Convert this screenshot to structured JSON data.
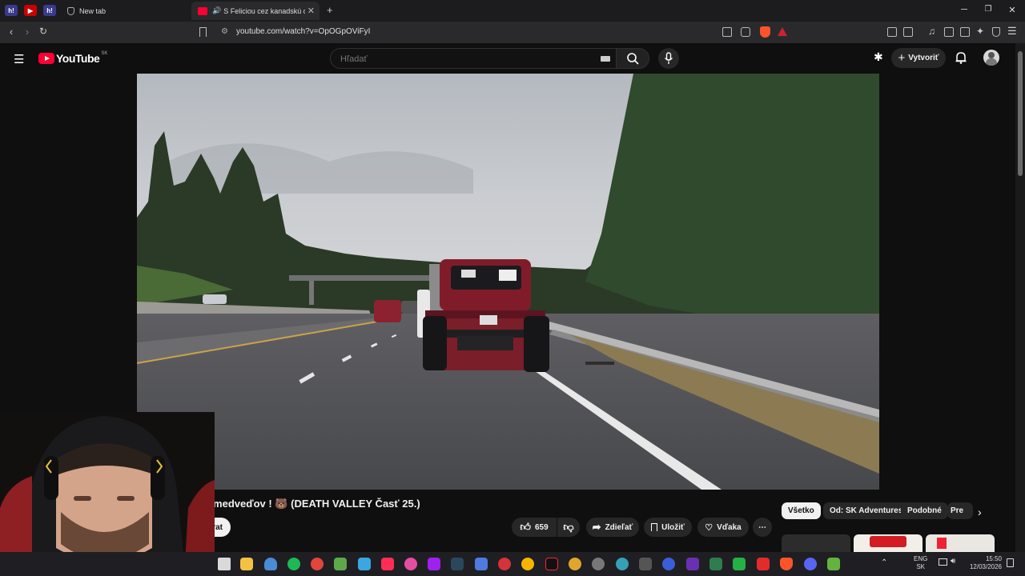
{
  "browser": {
    "tabs": [
      {
        "label": "New tab",
        "active": false
      },
      {
        "label": "S Feliciou cez kanadskú divočinu",
        "active": true
      }
    ],
    "pinned_tabs": [
      "h!",
      "youtube",
      "h!"
    ],
    "new_tab_label": "+",
    "url": "youtube.com/watch?v=OpOGpOViFyI"
  },
  "youtube": {
    "logo_text": "YouTube",
    "region": "SK",
    "search_placeholder": "Hľadať",
    "create_label": "Vytvoriť"
  },
  "video": {
    "title": "...í medveďov ! 🐻 (DEATH VALLEY Časť 25.)",
    "subscribe_partial": "rat",
    "actions": {
      "likes": "659",
      "share": "Zdieľať",
      "save": "Uložiť",
      "thanks": "Vďaka"
    }
  },
  "chips": [
    "Všetko",
    "Od: SK Adventures",
    "Podobné",
    "Pre"
  ],
  "taskbar": {
    "lang_top": "ENG",
    "lang_bottom": "SK",
    "time": "15:50",
    "date": "12/03/2026"
  },
  "colors": {
    "yt_red": "#ff0033",
    "brave_orange": "#fb542b",
    "bg": "#0f0f0f"
  }
}
